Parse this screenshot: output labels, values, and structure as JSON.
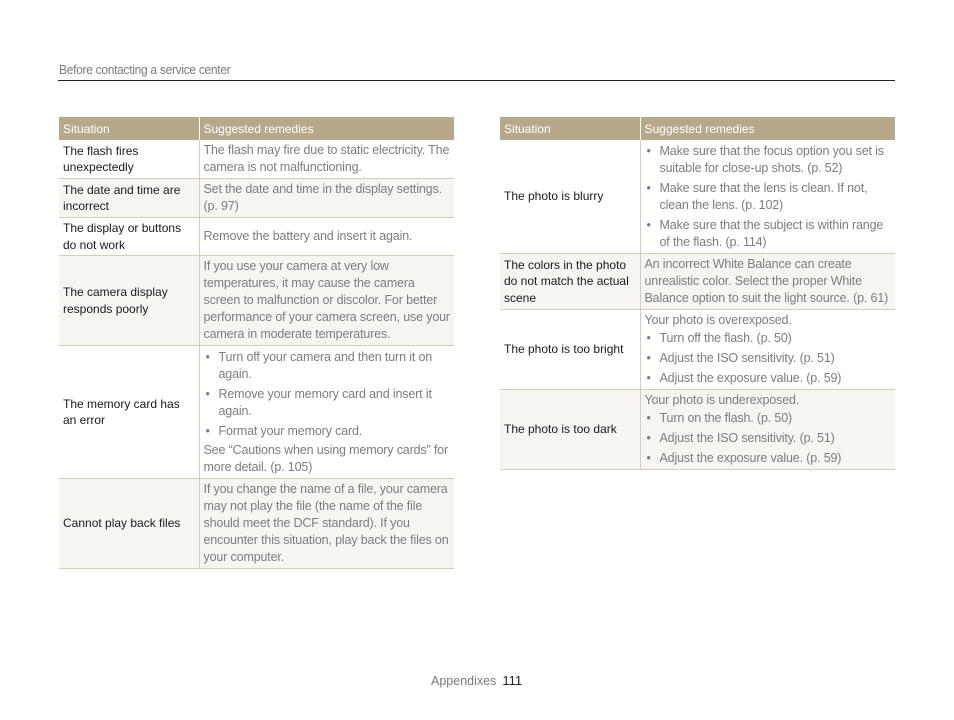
{
  "header": {
    "title": "Before contacting a service center"
  },
  "columns": {
    "situation": "Situation",
    "remedies": "Suggested remedies"
  },
  "left_table": [
    {
      "situation": "The flash fires unexpectedly",
      "pre": "The flash may fire due to static electricity. The camera is not malfunctioning.",
      "bullets": [],
      "post": "",
      "alt": false
    },
    {
      "situation": "The date and time are incorrect",
      "pre": "Set the date and time in the display settings. (p. 97)",
      "bullets": [],
      "post": "",
      "alt": true
    },
    {
      "situation": "The display or buttons do not work",
      "pre": "Remove the battery and insert it again.",
      "bullets": [],
      "post": "",
      "alt": false
    },
    {
      "situation": "The camera display responds poorly",
      "pre": "If you use your camera at very low temperatures, it may cause the camera screen to malfunction or discolor. For better performance of your camera screen, use your camera in moderate temperatures.",
      "bullets": [],
      "post": "",
      "alt": true
    },
    {
      "situation": "The memory card has an error",
      "pre": "",
      "bullets": [
        "Turn off your camera and then turn it on again.",
        "Remove your memory card and insert it again.",
        "Format your memory card."
      ],
      "post": "See “Cautions when using memory cards” for more detail. (p. 105)",
      "alt": false
    },
    {
      "situation": "Cannot play back files",
      "pre": "If you change the name of a file, your camera may not play the file (the name of the file should meet the DCF standard). If you encounter this situation, play back the files on your computer.",
      "bullets": [],
      "post": "",
      "alt": true
    }
  ],
  "right_table": [
    {
      "situation": "The photo is blurry",
      "pre": "",
      "bullets": [
        "Make sure that the focus option you set is suitable for close-up shots. (p. 52)",
        "Make sure that the lens is clean. If not, clean the lens. (p. 102)",
        "Make sure that the subject is within range of the flash. (p. 114)"
      ],
      "post": "",
      "alt": false
    },
    {
      "situation": "The colors in the photo do not match the actual scene",
      "pre": "An incorrect White Balance can create unrealistic color. Select the proper White Balance option to suit the light source. (p. 61)",
      "bullets": [],
      "post": "",
      "alt": true
    },
    {
      "situation": "The photo is too bright",
      "pre": "Your photo is overexposed.",
      "bullets": [
        "Turn off the flash. (p. 50)",
        "Adjust the ISO sensitivity. (p. 51)",
        "Adjust the exposure value. (p. 59)"
      ],
      "post": "",
      "alt": false
    },
    {
      "situation": "The photo is too dark",
      "pre": "Your photo is underexposed.",
      "bullets": [
        "Turn on the flash. (p. 50)",
        "Adjust the ISO sensitivity. (p. 51)",
        "Adjust the exposure value. (p. 59)"
      ],
      "post": "",
      "alt": true
    }
  ],
  "footer": {
    "section": "Appendixes",
    "page_number": "111"
  },
  "colors": {
    "header_bg": "#b8a88a",
    "alt_row_bg": "#f6f5f1",
    "rule": "#d7ccb8"
  }
}
